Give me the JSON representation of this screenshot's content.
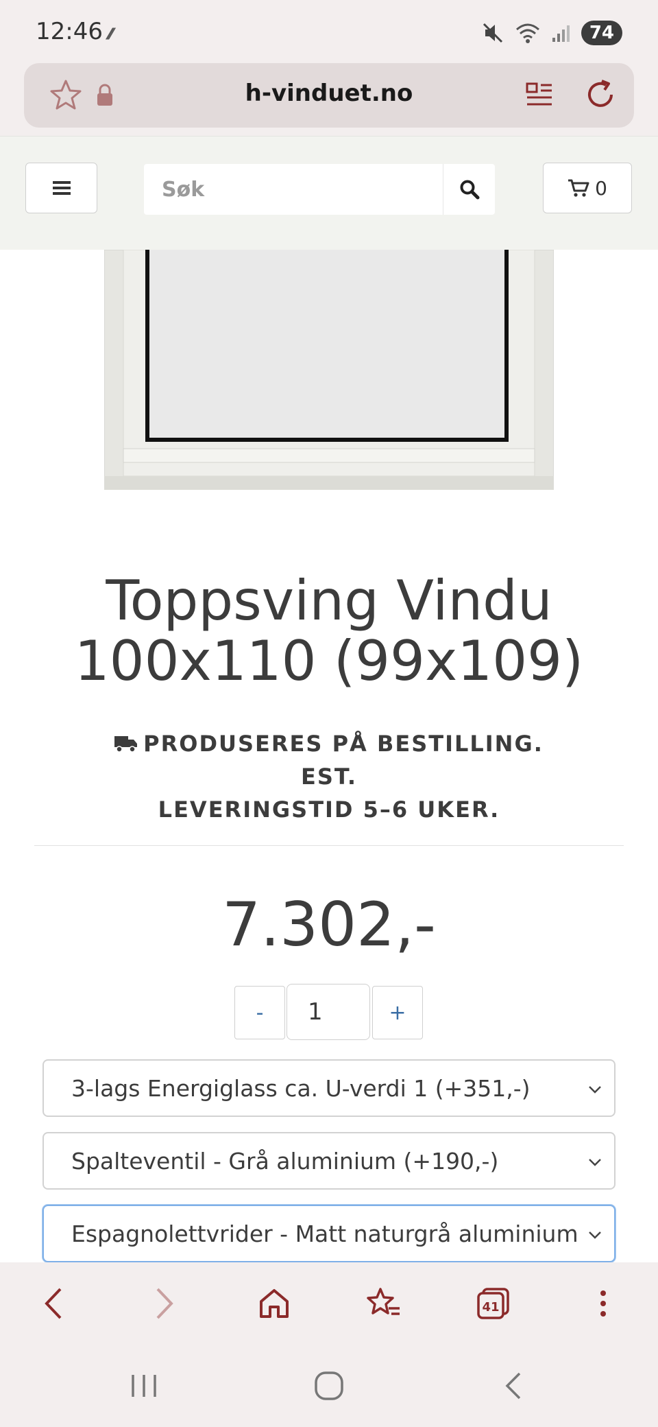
{
  "status_bar": {
    "time": "12:46",
    "network_glyph": "⁄⁄⁄",
    "battery": "74"
  },
  "browser": {
    "url": "h-vinduet.no",
    "tab_count": "41"
  },
  "header": {
    "search_placeholder": "Søk",
    "cart_count": "0"
  },
  "product": {
    "title_line1": "Toppsving Vindu",
    "title_line2": "100x110 (99x109)",
    "delivery_line1": "PRODUSERES PÅ BESTILLING. EST.",
    "delivery_line2": "LEVERINGSTID 5–6 UKER.",
    "price": "7.302,-"
  },
  "quantity": {
    "minus_label": "-",
    "value": "1",
    "plus_label": "+"
  },
  "options": [
    {
      "selected": "3-lags Energiglass ca. U-verdi 1 (+351,-)"
    },
    {
      "selected": "Spalteventil - Grå aluminium (+190,-)"
    },
    {
      "selected": "Espagnolettvrider - Matt naturgrå aluminium"
    }
  ],
  "colors": {
    "browser_accent": "#8b2a2a",
    "link_blue": "#3a6ea5",
    "focus_border": "#7fb0e8"
  }
}
